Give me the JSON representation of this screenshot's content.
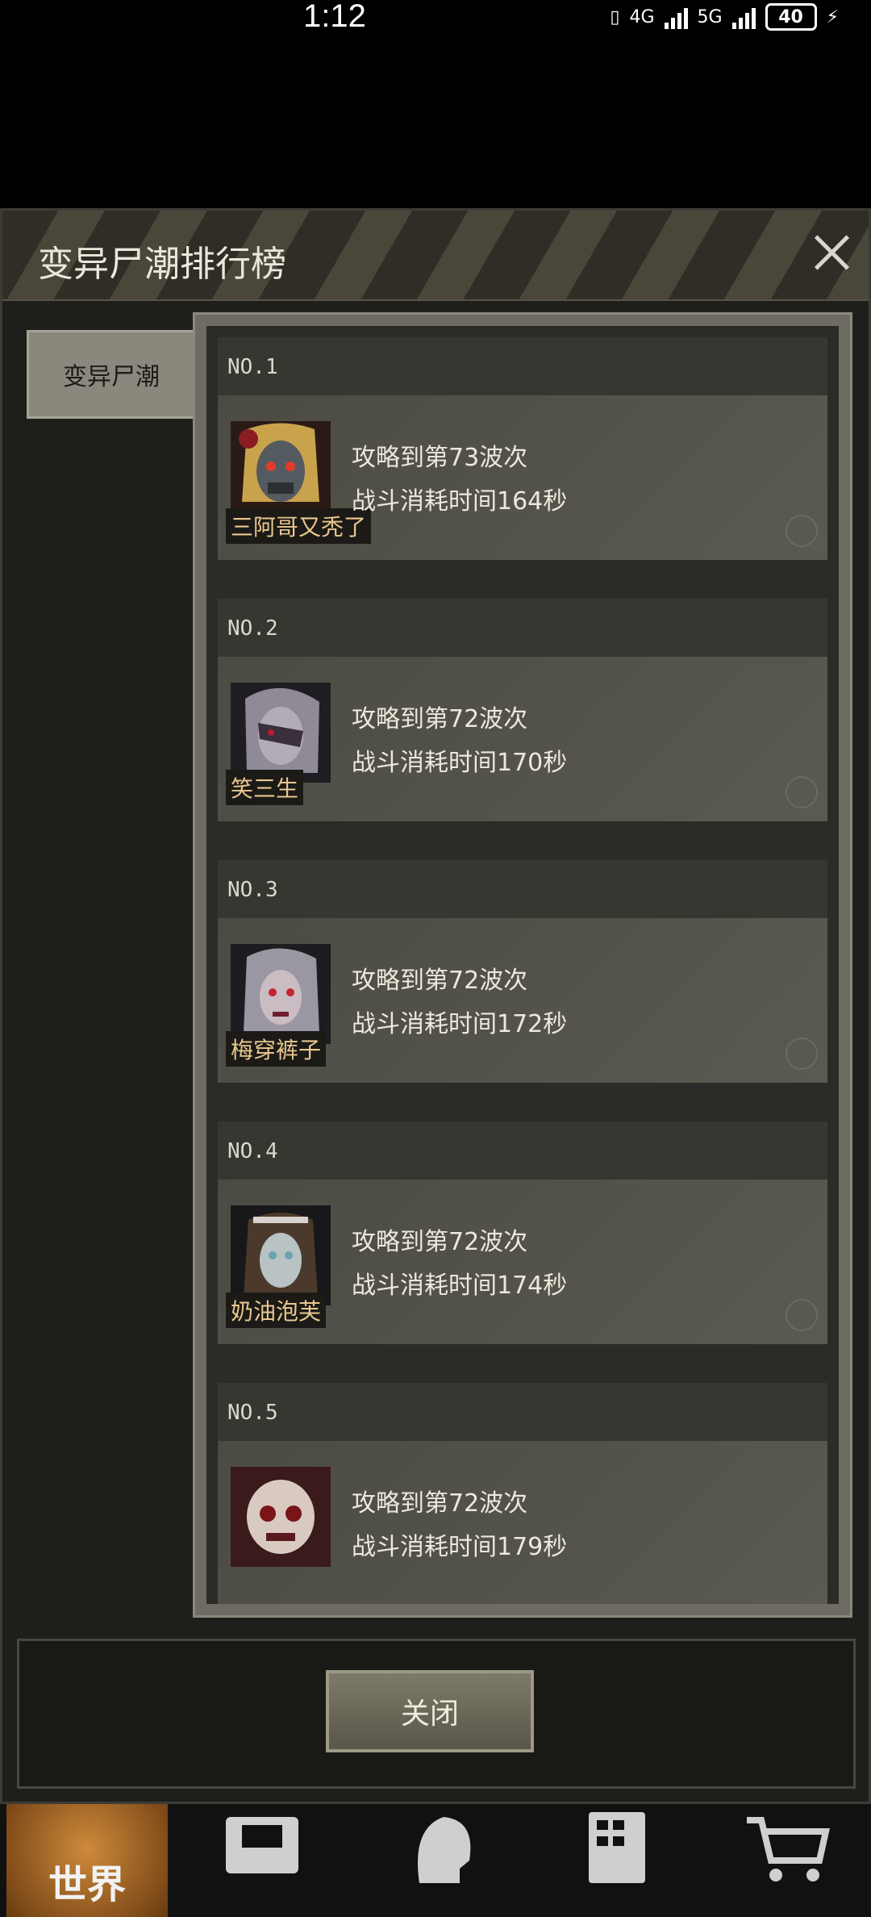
{
  "status": {
    "time": "1:12",
    "net1": "4G",
    "net2": "5G",
    "battery": "40"
  },
  "dialog": {
    "title": "变异尸潮排行榜",
    "tab": "变异尸潮",
    "close_label": "关闭"
  },
  "entries": [
    {
      "rank": "NO.1",
      "name": "三阿哥又秃了",
      "wave": "攻略到第73波次",
      "time": "战斗消耗时间164秒"
    },
    {
      "rank": "NO.2",
      "name": "笑三生",
      "wave": "攻略到第72波次",
      "time": "战斗消耗时间170秒"
    },
    {
      "rank": "NO.3",
      "name": "梅穿裤子",
      "wave": "攻略到第72波次",
      "time": "战斗消耗时间172秒"
    },
    {
      "rank": "NO.4",
      "name": "奶油泡芙",
      "wave": "攻略到第72波次",
      "time": "战斗消耗时间174秒"
    },
    {
      "rank": "NO.5",
      "name": "",
      "wave": "攻略到第72波次",
      "time": "战斗消耗时间179秒"
    }
  ],
  "nav": {
    "world_label": "世界",
    "icons": [
      "backpack-icon",
      "character-head-icon",
      "building-icon",
      "shop-cart-icon"
    ]
  }
}
